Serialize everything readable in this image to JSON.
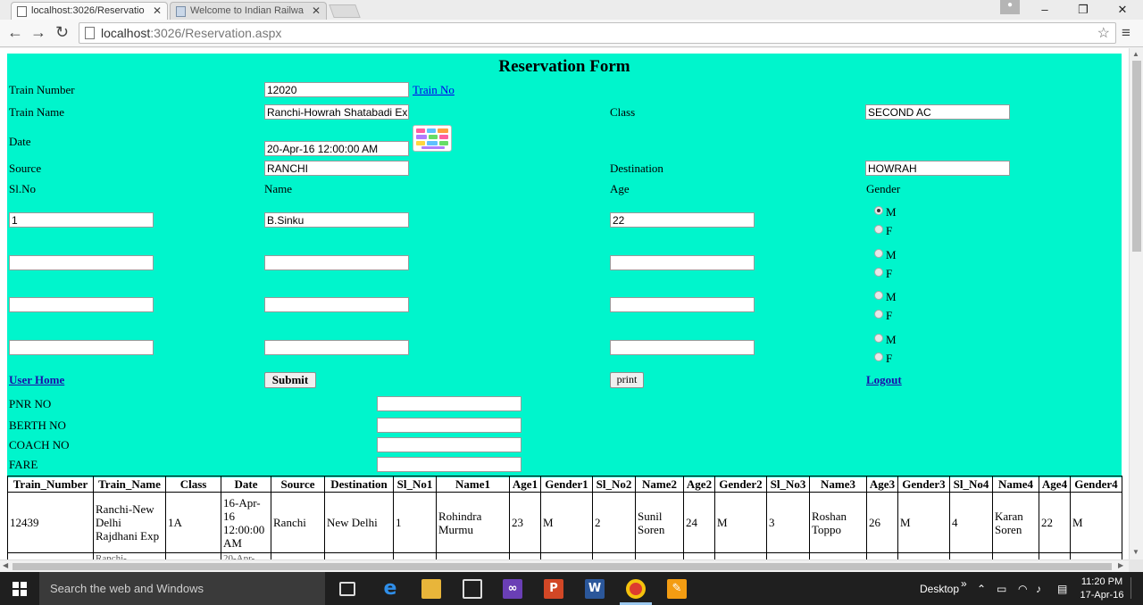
{
  "browser": {
    "tabs": [
      {
        "title": "localhost:3026/Reservatio",
        "active": true
      },
      {
        "title": "Welcome to Indian Railwa",
        "active": false
      }
    ],
    "url_host": "localhost",
    "url_path": ":3026/Reservation.aspx",
    "window_controls": {
      "minimize": "–",
      "maximize": "❐",
      "close": "✕"
    }
  },
  "form": {
    "title": "Reservation Form",
    "train_number_label": "Train Number",
    "train_number_value": "12020",
    "train_no_link": "Train No",
    "train_name_label": "Train Name",
    "train_name_value": "Ranchi-Howrah Shatabadi Ex",
    "class_label": "Class",
    "class_value": "SECOND AC",
    "date_label": "Date",
    "date_value": "20-Apr-16 12:00:00 AM",
    "source_label": "Source",
    "source_value": "RANCHI",
    "destination_label": "Destination",
    "destination_value": "HOWRAH",
    "slno_label": "Sl.No",
    "name_label": "Name",
    "age_label": "Age",
    "gender_label": "Gender",
    "passengers": [
      {
        "slno": "1",
        "name": "B.Sinku",
        "age": "22",
        "male": "M",
        "female": "F",
        "selected": "M"
      },
      {
        "slno": "",
        "name": "",
        "age": "",
        "male": "M",
        "female": "F",
        "selected": ""
      },
      {
        "slno": "",
        "name": "",
        "age": "",
        "male": "M",
        "female": "F",
        "selected": ""
      },
      {
        "slno": "",
        "name": "",
        "age": "",
        "male": "M",
        "female": "F",
        "selected": ""
      }
    ],
    "user_home_link": "User Home",
    "submit_label": "Submit",
    "print_label": "print",
    "logout_link": "Logout",
    "pnr_label": "PNR NO",
    "berth_label": "BERTH NO",
    "coach_label": "COACH NO",
    "fare_label": "FARE",
    "pnr_value": "",
    "berth_value": "",
    "coach_value": "",
    "fare_value": "",
    "background_color": "#00f5cc"
  },
  "table": {
    "headers": [
      "Train_Number",
      "Train_Name",
      "Class",
      "Date",
      "Source",
      "Destination",
      "Sl_No1",
      "Name1",
      "Age1",
      "Gender1",
      "Sl_No2",
      "Name2",
      "Age2",
      "Gender2",
      "Sl_No3",
      "Name3",
      "Age3",
      "Gender3",
      "Sl_No4",
      "Name4",
      "Age4",
      "Gender4"
    ],
    "rows": [
      [
        "12439",
        "Ranchi-New Delhi Rajdhani Exp",
        "1A",
        "16-Apr-16 12:00:00 AM",
        "Ranchi",
        "New Delhi",
        "1",
        "Rohindra Murmu",
        "23",
        "M",
        "2",
        "Sunil Soren",
        "24",
        "M",
        "3",
        "Roshan Toppo",
        "26",
        "M",
        "4",
        "Karan Soren",
        "22",
        "M"
      ]
    ],
    "partial_row": [
      "",
      "Ranchi-",
      "",
      "20-Apr-",
      "",
      "",
      "",
      "",
      "",
      "",
      "",
      "",
      "",
      "",
      "",
      "",
      "",
      "",
      "",
      "",
      "",
      ""
    ]
  },
  "taskbar": {
    "search_placeholder": "Search the web and Windows",
    "desktop_label": "Desktop",
    "time": "11:20 PM",
    "date": "17-Apr-16",
    "tray_chevrons": "»"
  }
}
